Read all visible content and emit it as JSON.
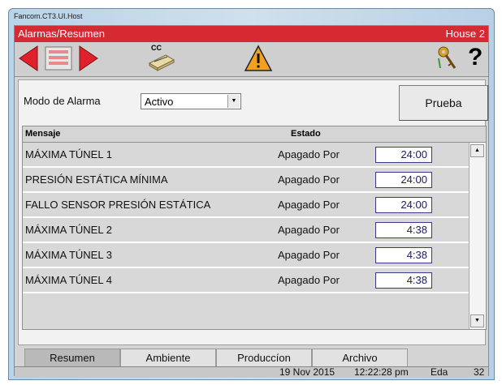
{
  "window": {
    "title": "Fancom.CT3.UI.Host"
  },
  "titlebar": {
    "left": "Alarmas/Resumen",
    "right": "House 2"
  },
  "toolbar": {
    "cc_label": "CC",
    "help_label": "?"
  },
  "alarm_mode": {
    "label": "Modo de Alarma",
    "value": "Activo"
  },
  "test_button": {
    "label": "Prueba"
  },
  "table": {
    "headers": {
      "message": "Mensaje",
      "state": "Estado"
    },
    "rows": [
      {
        "message": "MÁXIMA TÚNEL 1",
        "state": "Apagado Por",
        "time": "24:00"
      },
      {
        "message": "PRESIÓN ESTÁTICA MÍNIMA",
        "state": "Apagado Por",
        "time": "24:00"
      },
      {
        "message": "FALLO SENSOR PRESIÓN ESTÁTICA",
        "state": "Apagado Por",
        "time": "24:00"
      },
      {
        "message": "MÁXIMA TÚNEL 2",
        "state": "Apagado Por",
        "time": "4:38"
      },
      {
        "message": "MÁXIMA TÚNEL 3",
        "state": "Apagado Por",
        "time": "4:38"
      },
      {
        "message": "MÁXIMA TÚNEL 4",
        "state": "Apagado Por",
        "time": "4:38"
      }
    ]
  },
  "tabs": [
    {
      "label": "Resumen",
      "active": true
    },
    {
      "label": "Ambiente"
    },
    {
      "label": "Produccíon"
    },
    {
      "label": "Archivo"
    }
  ],
  "status": {
    "date": "19 Nov 2015",
    "time": "12:22:28 pm",
    "user": "Eda",
    "number": "32"
  },
  "colors": {
    "titlebar": "#d62a32",
    "arrow": "#e0202a",
    "warning": "#f2a21a"
  }
}
